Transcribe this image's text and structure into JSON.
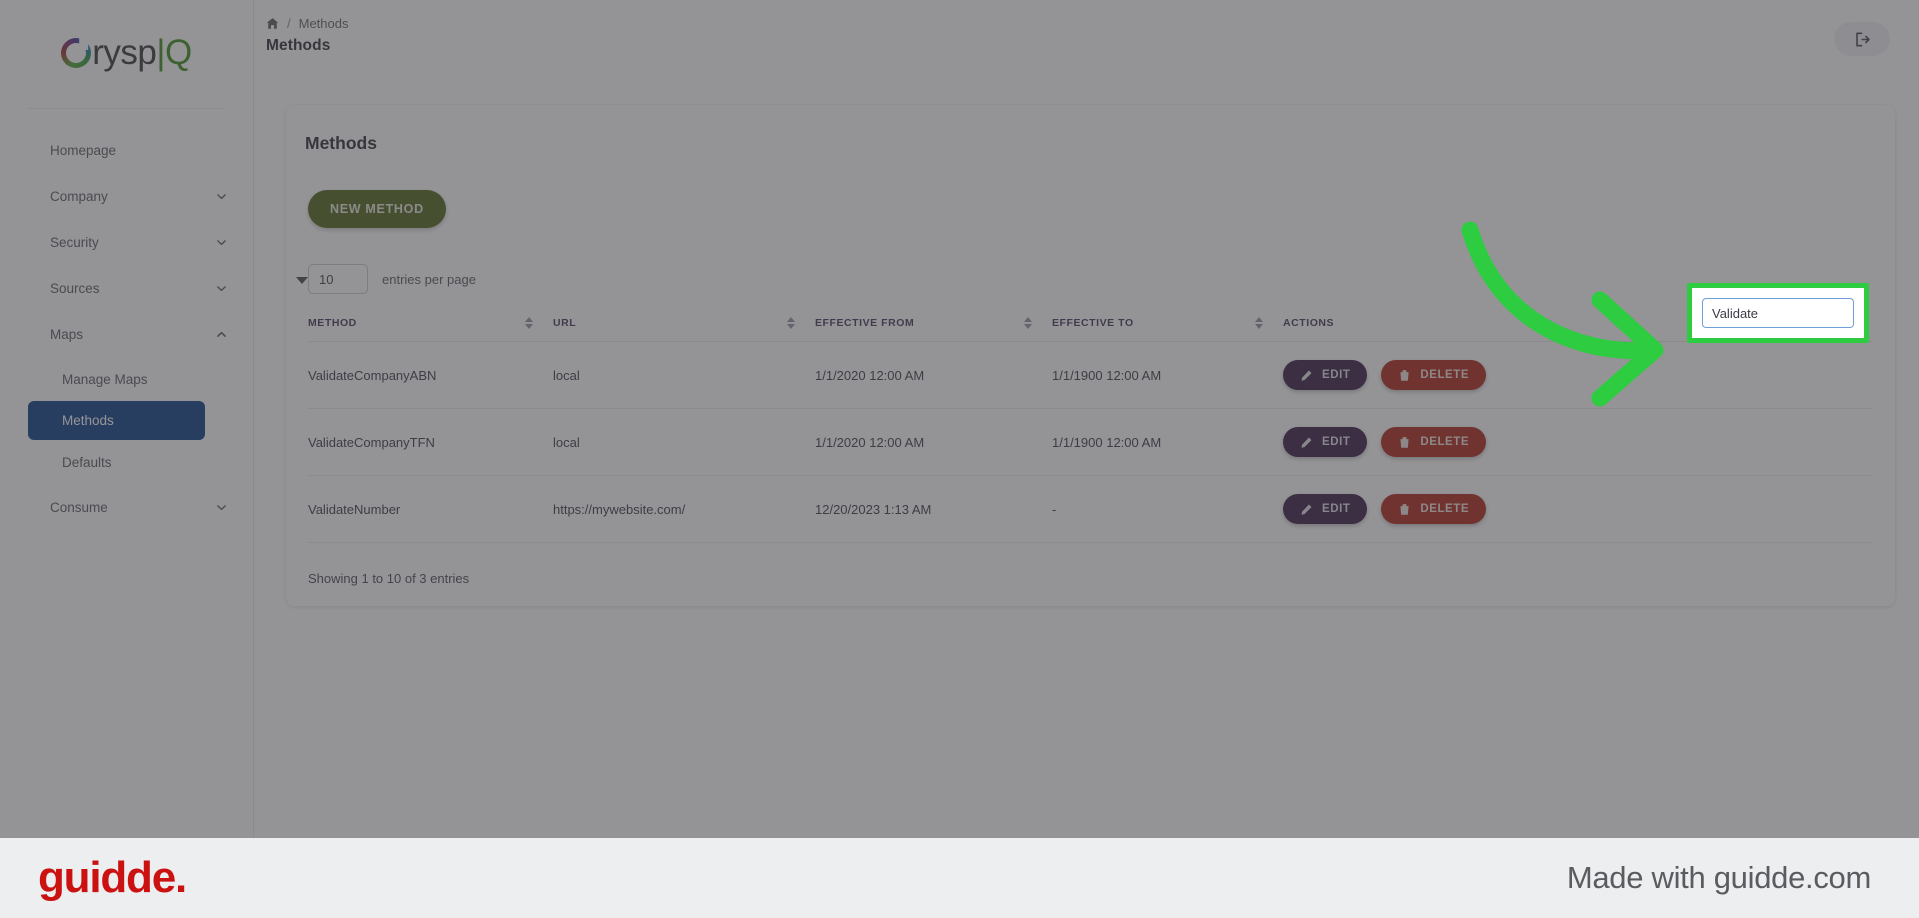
{
  "brand": {
    "logo_prefix": "C",
    "logo_mid": "rysp",
    "logo_bar": "|",
    "logo_suffix": "Q",
    "accent_green": "#3f8f1e",
    "highlight_green": "#2ecc40"
  },
  "sidebar": {
    "items": [
      {
        "label": "Homepage",
        "expandable": false
      },
      {
        "label": "Company",
        "expandable": true,
        "icon": "chevron-down-icon"
      },
      {
        "label": "Security",
        "expandable": true,
        "icon": "chevron-down-icon"
      },
      {
        "label": "Sources",
        "expandable": true,
        "icon": "chevron-down-icon"
      },
      {
        "label": "Maps",
        "expandable": true,
        "icon": "chevron-up-icon",
        "expanded": true
      },
      {
        "label": "Consume",
        "expandable": true,
        "icon": "chevron-down-icon"
      }
    ],
    "maps_children": [
      {
        "label": "Manage Maps",
        "active": false
      },
      {
        "label": "Methods",
        "active": true
      },
      {
        "label": "Defaults",
        "active": false
      }
    ]
  },
  "header": {
    "home_icon": "home-icon",
    "breadcrumb_separator": "/",
    "breadcrumb_current": "Methods",
    "page_title": "Methods",
    "logout_icon": "logout-icon"
  },
  "card": {
    "title": "Methods",
    "new_method_label": "NEW METHOD",
    "entries_value": "10",
    "entries_label": "entries per page",
    "search_value": "Validate",
    "showing_text": "Showing 1 to 10 of 3 entries"
  },
  "table": {
    "columns": [
      {
        "label": "METHOD",
        "sortable": true
      },
      {
        "label": "URL",
        "sortable": true
      },
      {
        "label": "EFFECTIVE FROM",
        "sortable": true
      },
      {
        "label": "EFFECTIVE TO",
        "sortable": true
      },
      {
        "label": "ACTIONS",
        "sortable": true
      }
    ],
    "rows": [
      {
        "method": "ValidateCompanyABN",
        "url": "local",
        "effective_from": "1/1/2020 12:00 AM",
        "effective_to": "1/1/1900 12:00 AM",
        "edit_label": "EDIT",
        "delete_label": "DELETE"
      },
      {
        "method": "ValidateCompanyTFN",
        "url": "local",
        "effective_from": "1/1/2020 12:00 AM",
        "effective_to": "1/1/1900 12:00 AM",
        "edit_label": "EDIT",
        "delete_label": "DELETE"
      },
      {
        "method": "ValidateNumber",
        "url": "https://mywebsite.com/",
        "effective_from": "12/20/2023 1:13 AM",
        "effective_to": "-",
        "edit_label": "EDIT",
        "delete_label": "DELETE"
      }
    ]
  },
  "annotation": {
    "arrow": "curved-arrow-right",
    "arrow_color": "#2ecc40",
    "highlight_target": "search-input"
  },
  "footer": {
    "logo_text": "guidde.",
    "made_with": "Made with guidde.com"
  }
}
